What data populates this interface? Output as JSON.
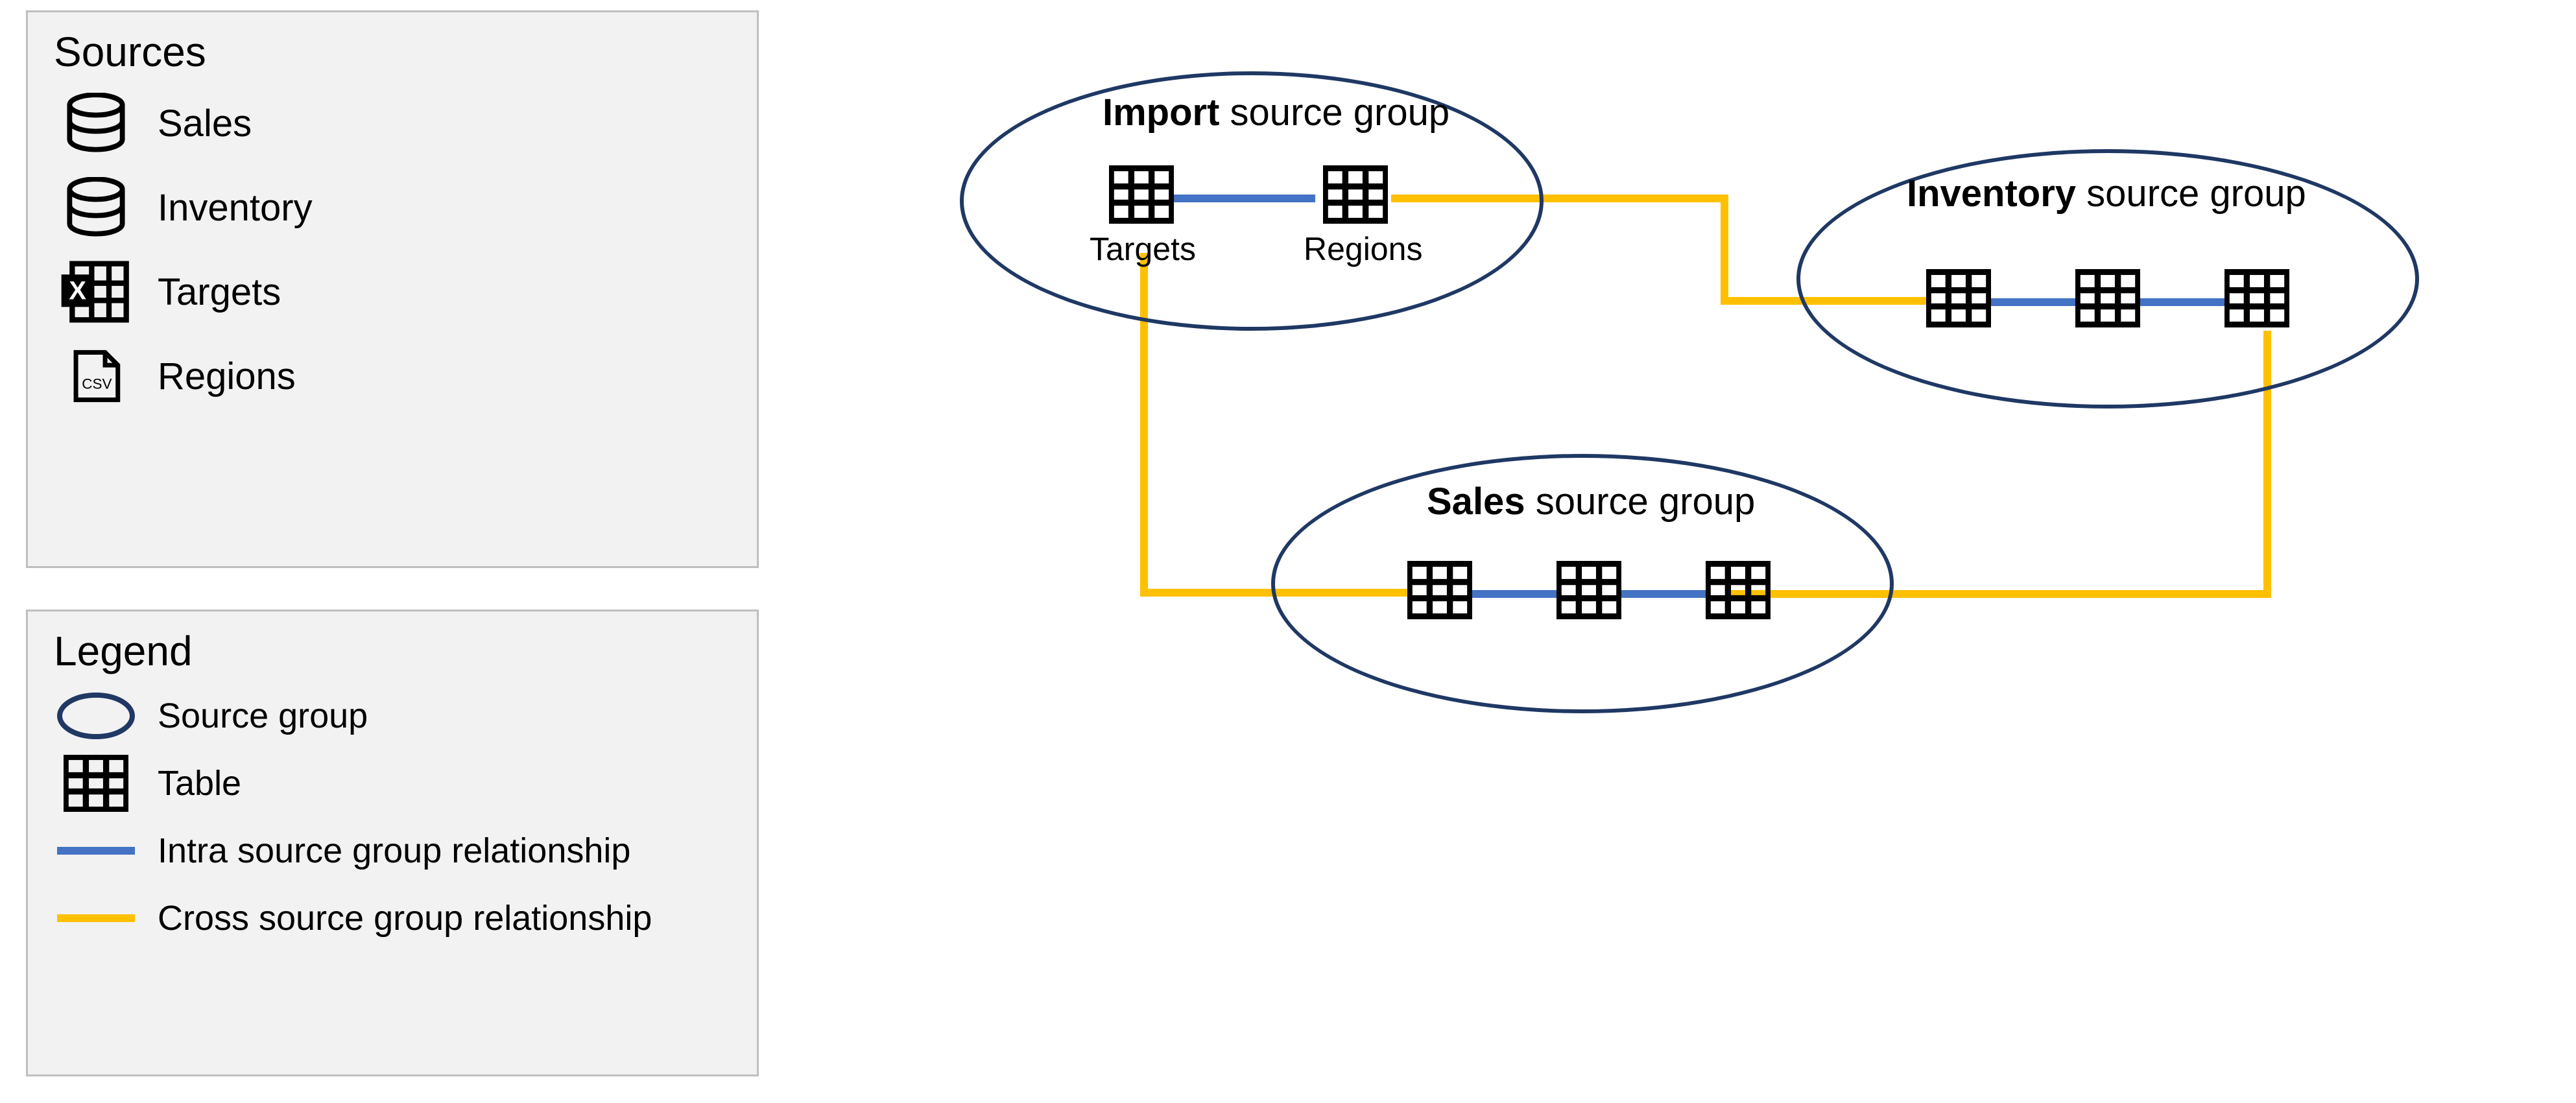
{
  "colors": {
    "intra_relationship": "#4472c4",
    "cross_relationship": "#ffc000",
    "source_group_outline": "#1f3864",
    "panel_bg": "#f2f2f2",
    "panel_border": "#bfbfbf"
  },
  "sources_panel": {
    "title": "Sources",
    "items": [
      {
        "icon": "database-icon",
        "label": "Sales"
      },
      {
        "icon": "database-icon",
        "label": "Inventory"
      },
      {
        "icon": "excel-icon",
        "label": "Targets"
      },
      {
        "icon": "csv-file-icon",
        "label": "Regions"
      }
    ]
  },
  "legend_panel": {
    "title": "Legend",
    "items": [
      {
        "icon": "ellipse-icon",
        "label": "Source group"
      },
      {
        "icon": "table-icon",
        "label": "Table"
      },
      {
        "icon": "intra-line-icon",
        "label": "Intra source group relationship"
      },
      {
        "icon": "cross-line-icon",
        "label": "Cross source group relationship"
      }
    ]
  },
  "diagram": {
    "source_groups": [
      {
        "id": "import",
        "title_bold": "Import",
        "title_rest": " source group",
        "tables": [
          {
            "label": "Targets"
          },
          {
            "label": "Regions"
          }
        ]
      },
      {
        "id": "inventory",
        "title_bold": "Inventory",
        "title_rest": " source group",
        "tables": [
          {},
          {},
          {}
        ]
      },
      {
        "id": "sales",
        "title_bold": "Sales",
        "title_rest": " source group",
        "tables": [
          {},
          {},
          {}
        ]
      }
    ],
    "intra_relationships": [
      {
        "group": "import",
        "between": [
          "Targets",
          "Regions"
        ]
      },
      {
        "group": "inventory",
        "between": [
          "t1",
          "t2"
        ]
      },
      {
        "group": "inventory",
        "between": [
          "t2",
          "t3"
        ]
      },
      {
        "group": "sales",
        "between": [
          "t1",
          "t2"
        ]
      },
      {
        "group": "sales",
        "between": [
          "t2",
          "t3"
        ]
      }
    ],
    "cross_relationships": [
      {
        "from_group": "import",
        "from_table": "Regions",
        "to_group": "inventory",
        "to_table": "t1"
      },
      {
        "from_group": "import",
        "from_table": "Targets",
        "to_group": "sales",
        "to_table": "t1"
      },
      {
        "from_group": "inventory",
        "from_table": "t3",
        "to_group": "sales",
        "to_table": "t3"
      }
    ]
  }
}
